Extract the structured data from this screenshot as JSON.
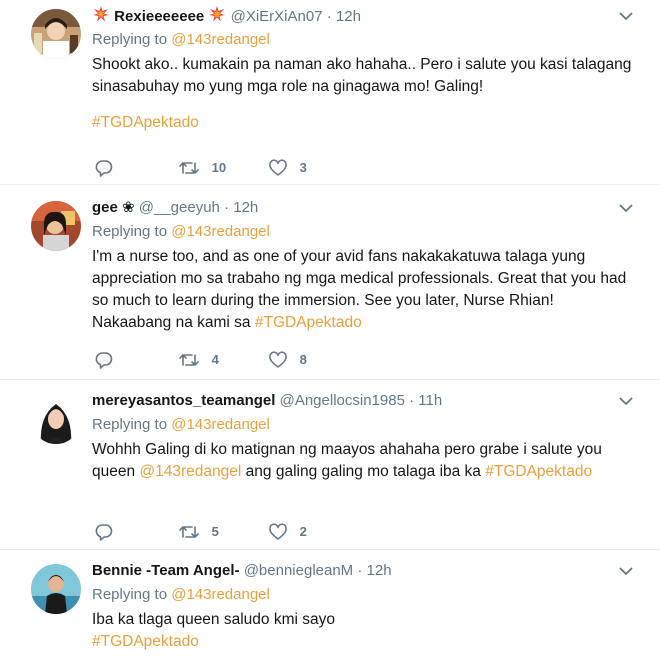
{
  "tweets": [
    {
      "name": "Rexieeeeeee",
      "handle": "@XiErXiAn07",
      "time": "12h",
      "replying_prefix": "Replying to",
      "replying_to": "@143redangel",
      "text": "Shookt ako.. kumakain pa naman ako hahaha.. Pero i salute you kasi talagang sinasabuhay mo yung mga role na ginagawa mo! Galing!",
      "hashtag": "#TGDApektado",
      "retweets": "10",
      "likes": "3"
    },
    {
      "name": "gee ❀",
      "handle": "@__geeyuh",
      "time": "12h",
      "replying_prefix": "Replying to",
      "replying_to": "@143redangel",
      "text": "I'm a nurse too, and as one of your avid fans nakakakatuwa talaga yung appreciation mo sa trabaho ng mga medical professionals. Great that you had so much to learn during the immersion. See you later, Nurse Rhian! Nakaabang na kami sa",
      "hashtag": "#TGDApektado",
      "retweets": "4",
      "likes": "8"
    },
    {
      "name": "mereyasantos_teamangel",
      "handle": "@Angellocsin1985",
      "time": "11h",
      "replying_prefix": "Replying to",
      "replying_to": "@143redangel",
      "text_before": "Wohhh Galing di ko matignan ng maayos ahahaha pero grabe i salute you queen",
      "mention": "@143redangel",
      "text_after": "ang galing galing mo talaga iba ka",
      "hashtag": "#TGDApektado",
      "retweets": "5",
      "likes": "2"
    },
    {
      "name": "Bennie -Team Angel-",
      "handle": "@bennieglеanM",
      "time": "12h",
      "replying_prefix": "Replying to",
      "replying_to": "@143redangel",
      "text": "Iba ka tlaga queen saludo kmi sayo",
      "hashtag": "#TGDApektado"
    }
  ],
  "separator": "·",
  "icons": {
    "reply": "reply-icon",
    "retweet": "retweet-icon",
    "like": "heart-icon",
    "more": "chevron-down-icon"
  },
  "colors": {
    "accent": "#e8a03f",
    "secondary_text": "#657786",
    "primary_text": "#14171a",
    "divider": "#e6ecf0"
  }
}
